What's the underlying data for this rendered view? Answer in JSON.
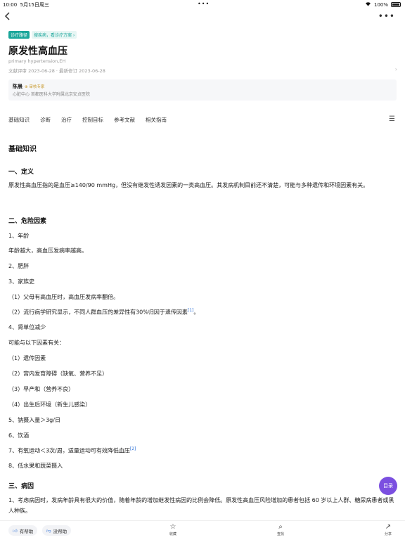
{
  "status": {
    "time": "10:00",
    "date": "5月15日周三",
    "battery": "100%"
  },
  "tags": {
    "badge": "诊疗路径",
    "link": "搜疾病，看诊疗方案 ›"
  },
  "article": {
    "title": "原发性高血压",
    "subtitle_en": "primary hypertension,EH",
    "dates": "文献评审 2023-06-28 · 最新修订 2023-06-28"
  },
  "author": {
    "name": "陈晨",
    "role": "审核专家",
    "affiliation": "心脏中心 首都医科大学附属北京安贞医院"
  },
  "tabs": [
    "基础知识",
    "诊断",
    "治疗",
    "控制目标",
    "参考文献",
    "相关指南"
  ],
  "content": {
    "section_title": "基础知识",
    "h1": "一、定义",
    "definition": "原发性高血压指的是血压≥140/90 mmHg，但没有继发性诱发因素的一类高血压。其发病机制目前还不清楚，可能与多种遗传和环境因素有关。",
    "h2": "二、危险因素",
    "risk_age": "1、年龄",
    "risk_age_desc": "年龄越大，高血压发病率越高。",
    "risk_obesity": "2、肥胖",
    "risk_family": "3、家族史",
    "family_1": "（1）父母有高血压时，高血压发病率翻倍。",
    "family_2": "（2）流行病学研究显示，不同人群血压的差异性有30%归因于遗传因素",
    "ref_1": "[1]",
    "family_2_end": "。",
    "risk_nephron": "4、肾单位减少",
    "nephron_intro": "可能与以下因素有关：",
    "nephron_1": "（1）遗传因素",
    "nephron_2": "（2）宫内发育障碍（缺氧、营养不足）",
    "nephron_3": "（3）早产和（营养不良）",
    "nephron_4": "（4）出生后环境（新生儿感染）",
    "risk_sodium": "5、钠摄入量＞3g/日",
    "risk_alcohol": "6、饮酒",
    "risk_exercise": "7、有氧运动＜3次/周，适量运动可有效降低血压",
    "ref_2": "[2]",
    "risk_fruit": "8、低水果和蔬菜摄入",
    "h3": "三、病因",
    "cause_1": "1、考虑病因时，发病年龄具有很大的价值，随着年龄的增加继发性病因的比例会降低。原发性高血压风险增加的患者包括 60 岁以上人群、糖尿病患者或黑人种族。"
  },
  "toc_button": "目录",
  "bottom_bar": {
    "helpful": "有帮助",
    "unhelpful": "没帮助",
    "favorite": "收藏",
    "find": "查找",
    "share": "分享"
  },
  "colors": {
    "accent": "#1aa69a",
    "toc": "#7b4fe0",
    "link": "#2c6fd6"
  }
}
